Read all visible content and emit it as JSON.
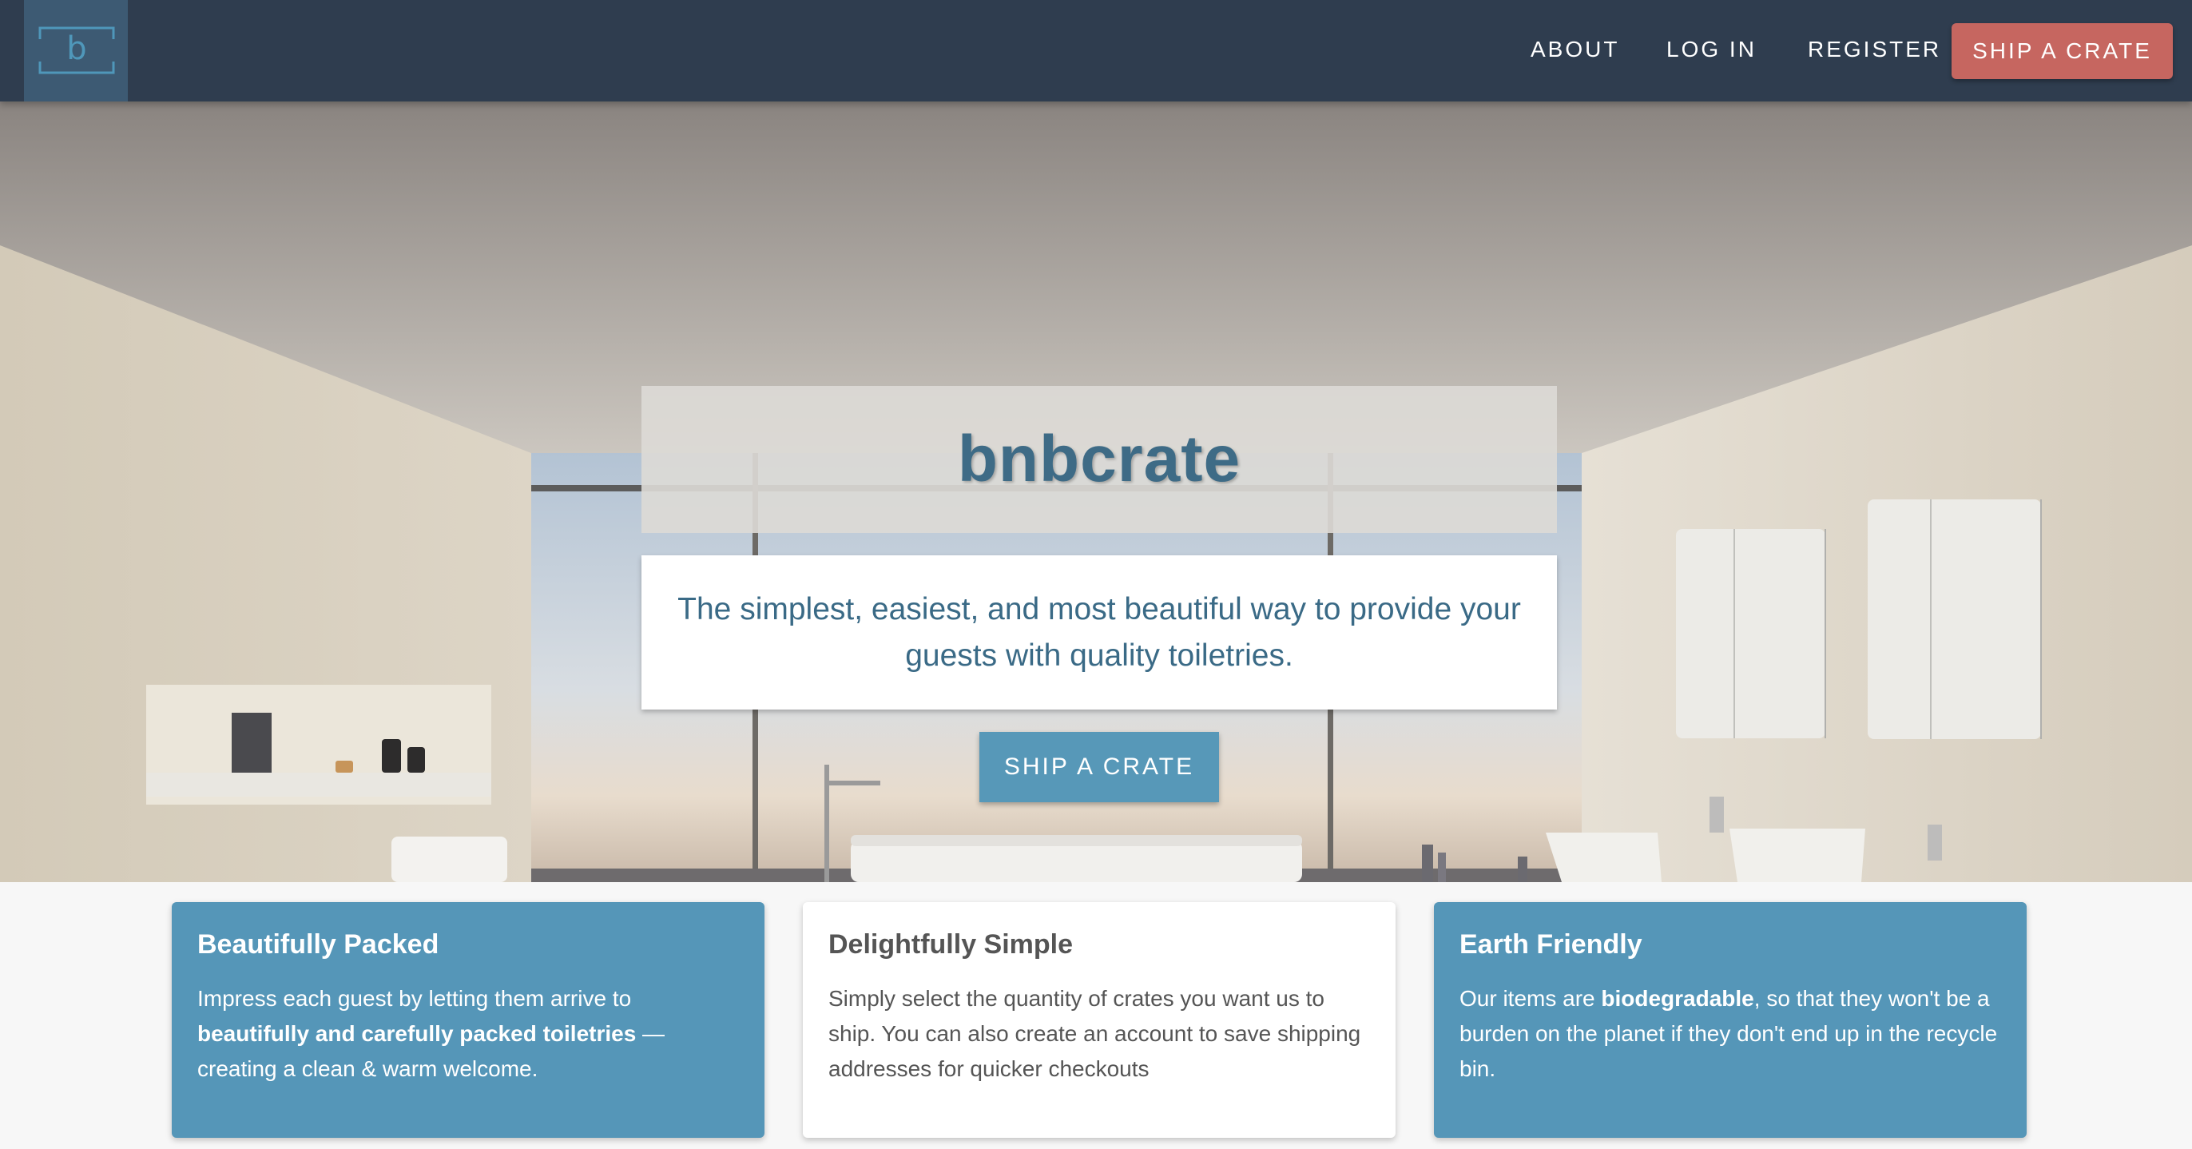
{
  "logo": {
    "letter": "b"
  },
  "nav": {
    "about": "ABOUT",
    "login": "LOG IN",
    "register": "REGISTER",
    "cta": "SHIP A CRATE"
  },
  "hero": {
    "title": "bnbcrate",
    "subtitle": "The simplest, easiest, and most beautiful way to provide your guests with quality toiletries.",
    "cta": "SHIP A CRATE"
  },
  "cards": [
    {
      "title": "Beautifully Packed",
      "text_before": "Impress each guest by letting them arrive to ",
      "text_bold": "beautifully and carefully packed toiletries",
      "text_after": " — creating a clean & warm welcome."
    },
    {
      "title": "Delightfully Simple",
      "text_before": "Simply select the quantity of crates you want us to ship. You can also create an account to save shipping addresses for quicker checkouts",
      "text_bold": "",
      "text_after": ""
    },
    {
      "title": "Earth Friendly",
      "text_before": "Our items are ",
      "text_bold": "biodegradable",
      "text_after": ", so that they won't be a burden on the planet if they don't end up in the recycle bin."
    }
  ],
  "colors": {
    "navbar": "#2f3d4f",
    "logo_bg": "#3d5a73",
    "nav_cta": "#c66660",
    "primary_blue": "#5596b8",
    "title_text": "#3e6b86"
  },
  "icons": {
    "logo": "bnbcrate-logo-icon"
  }
}
